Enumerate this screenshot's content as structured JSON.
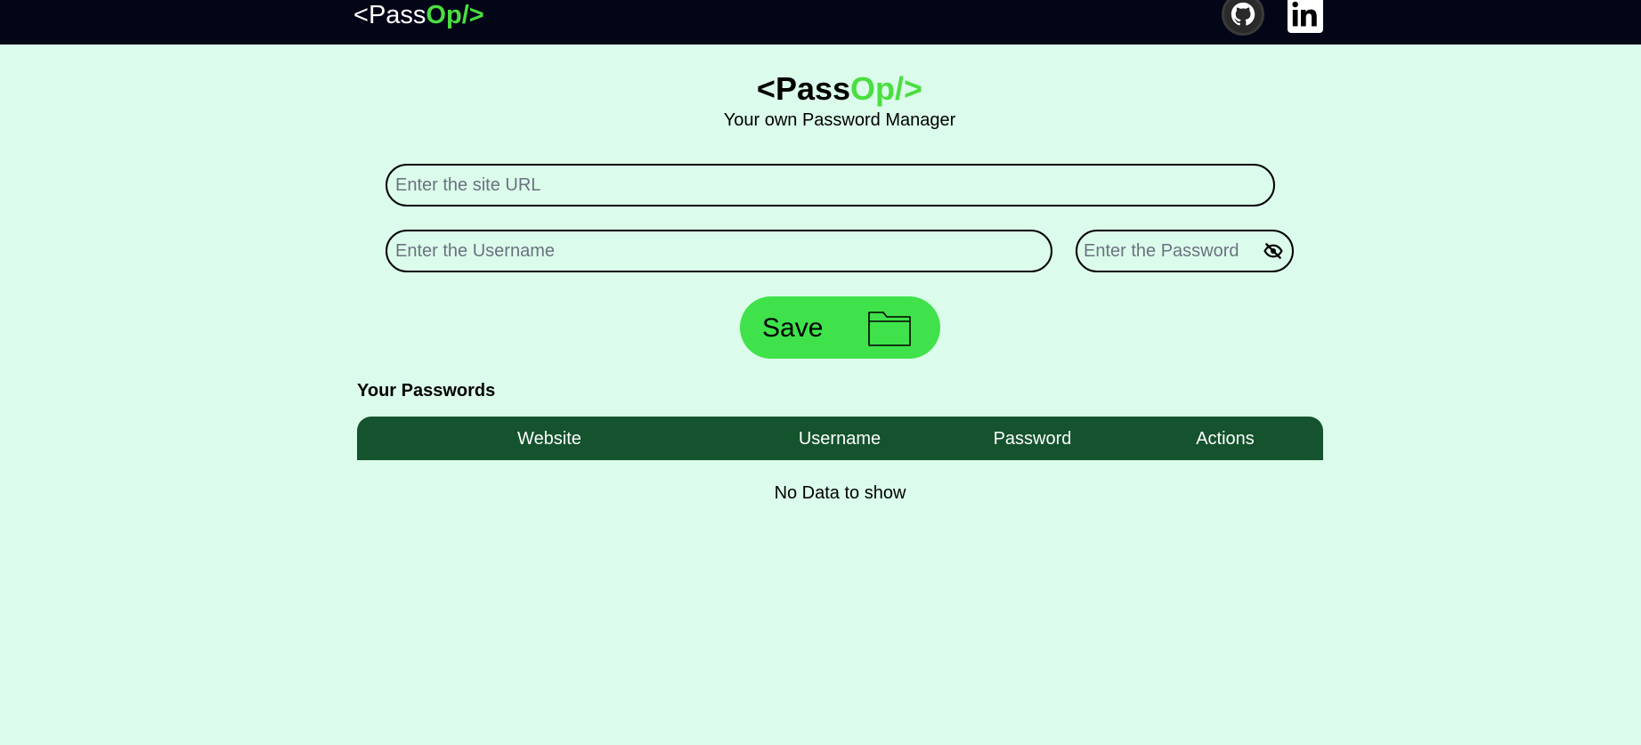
{
  "nav": {
    "logo_lt": "<",
    "logo_pass": "Pass",
    "logo_op": "Op/>",
    "github_icon": "github-icon",
    "linkedin_icon": "linkedin-icon"
  },
  "header": {
    "brand_lt": "<",
    "brand_pass": "Pass",
    "brand_op": "Op/>",
    "tagline": "Your own Password Manager"
  },
  "form": {
    "url_placeholder": "Enter the site URL",
    "url_value": "",
    "username_placeholder": "Enter the Username",
    "username_value": "",
    "password_placeholder": "Enter the Password",
    "password_value": "",
    "eye_icon": "eye-off-icon",
    "save_label": "Save",
    "save_icon": "folder-icon"
  },
  "passwords": {
    "title": "Your Passwords",
    "columns": [
      "Website",
      "Username",
      "Password",
      "Actions"
    ],
    "rows": [],
    "empty_message": "No Data to show"
  },
  "colors": {
    "background": "#dbfceb",
    "navbar": "#020617",
    "accent_green": "#4ade40",
    "save_button": "#3fe24a",
    "table_header": "#14532d"
  }
}
